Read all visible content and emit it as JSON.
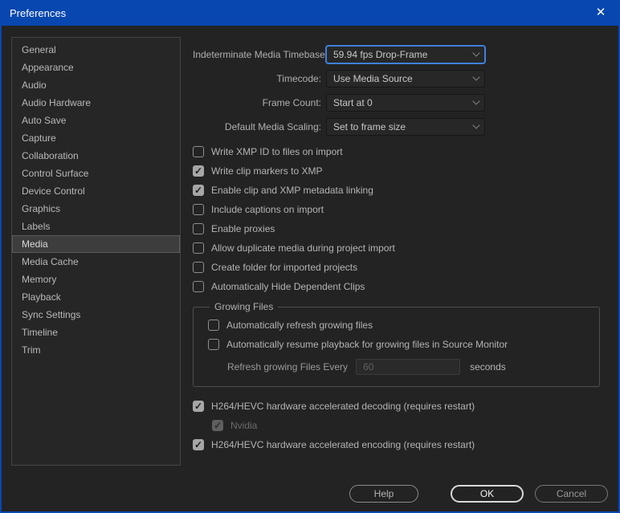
{
  "window": {
    "title": "Preferences",
    "close_icon": "✕"
  },
  "colors": {
    "titlebar_blue": "#0847af",
    "focus_blue": "#3f80de",
    "background": "#232323",
    "sidebar_selected": "#3d3d3d"
  },
  "sidebar": {
    "selected": "Media",
    "items": [
      "General",
      "Appearance",
      "Audio",
      "Audio Hardware",
      "Auto Save",
      "Capture",
      "Collaboration",
      "Control Surface",
      "Device Control",
      "Graphics",
      "Labels",
      "Media",
      "Media Cache",
      "Memory",
      "Playback",
      "Sync Settings",
      "Timeline",
      "Trim"
    ]
  },
  "form": {
    "dropdowns": [
      {
        "label": "Indeterminate Media Timebase:",
        "value": "59.94 fps Drop-Frame",
        "focused": true
      },
      {
        "label": "Timecode:",
        "value": "Use Media Source",
        "focused": false
      },
      {
        "label": "Frame Count:",
        "value": "Start at 0",
        "focused": false
      },
      {
        "label": "Default Media Scaling:",
        "value": "Set to frame size",
        "focused": false
      }
    ],
    "checkboxes": [
      {
        "label": "Write XMP ID to files on import",
        "checked": false
      },
      {
        "label": "Write clip markers to XMP",
        "checked": true
      },
      {
        "label": "Enable clip and XMP metadata linking",
        "checked": true
      },
      {
        "label": "Include captions on import",
        "checked": false
      },
      {
        "label": "Enable proxies",
        "checked": false
      },
      {
        "label": "Allow duplicate media during project import",
        "checked": false
      },
      {
        "label": "Create folder for imported projects",
        "checked": false
      },
      {
        "label": "Automatically Hide Dependent Clips",
        "checked": false
      }
    ],
    "growing_files": {
      "legend": "Growing Files",
      "checkboxes": [
        {
          "label": "Automatically refresh growing files",
          "checked": false
        },
        {
          "label": "Automatically resume playback for growing files in Source Monitor",
          "checked": false
        }
      ],
      "refresh_label": "Refresh growing Files Every",
      "refresh_value": "60",
      "refresh_suffix": "seconds"
    },
    "hardware": [
      {
        "label": "H264/HEVC hardware accelerated decoding (requires restart)",
        "checked": true,
        "disabled": false
      },
      {
        "label": "Nvidia",
        "checked": true,
        "disabled": true
      },
      {
        "label": "H264/HEVC hardware accelerated encoding (requires restart)",
        "checked": true,
        "disabled": false
      }
    ]
  },
  "footer": {
    "help": "Help",
    "ok": "OK",
    "cancel": "Cancel"
  }
}
